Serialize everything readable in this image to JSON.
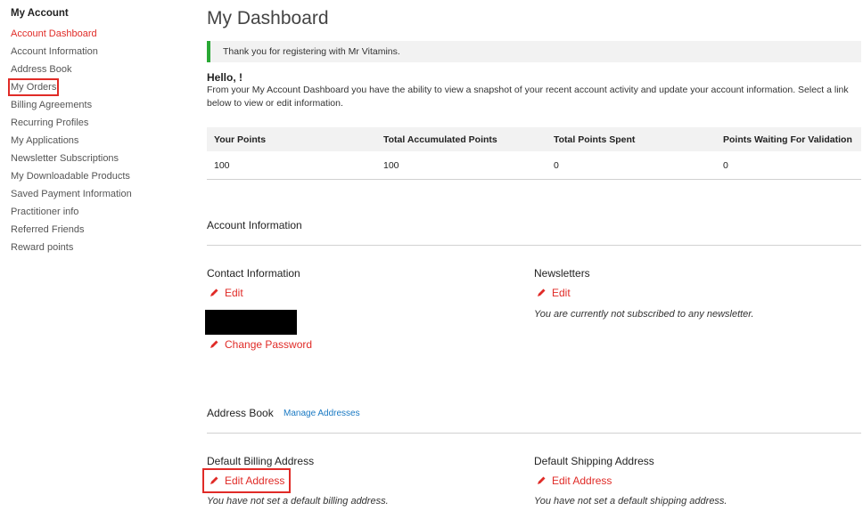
{
  "sidebar": {
    "title": "My Account",
    "items": [
      {
        "label": "Account Dashboard"
      },
      {
        "label": "Account Information"
      },
      {
        "label": "Address Book"
      },
      {
        "label": "My Orders"
      },
      {
        "label": "Billing Agreements"
      },
      {
        "label": "Recurring Profiles"
      },
      {
        "label": "My Applications"
      },
      {
        "label": "Newsletter Subscriptions"
      },
      {
        "label": "My Downloadable Products"
      },
      {
        "label": "Saved Payment Information"
      },
      {
        "label": "Practitioner info"
      },
      {
        "label": "Referred Friends"
      },
      {
        "label": "Reward points"
      }
    ]
  },
  "main": {
    "title": "My Dashboard",
    "notice": "Thank you for registering with Mr Vitamins.",
    "hello": "Hello, !",
    "intro": "From your My Account Dashboard you have the ability to view a snapshot of your recent account activity and update your account information. Select a link below to view or edit information.",
    "points": {
      "headers": [
        "Your Points",
        "Total Accumulated Points",
        "Total Points Spent",
        "Points Waiting For Validation"
      ],
      "values": [
        "100",
        "100",
        "0",
        "0"
      ]
    },
    "account_info": {
      "title": "Account Information",
      "contact": {
        "title": "Contact Information",
        "edit": "Edit",
        "change_password": "Change Password"
      },
      "newsletters": {
        "title": "Newsletters",
        "edit": "Edit",
        "note": "You are currently not subscribed to any newsletter."
      }
    },
    "address_book": {
      "title": "Address Book",
      "manage": "Manage Addresses",
      "billing": {
        "title": "Default Billing Address",
        "edit": "Edit Address",
        "note": "You have not set a default billing address."
      },
      "shipping": {
        "title": "Default Shipping Address",
        "edit": "Edit Address",
        "note": "You have not set a default shipping address."
      }
    }
  },
  "colors": {
    "accent": "#e02b27",
    "link": "#1979c3",
    "success": "#2aa835"
  }
}
